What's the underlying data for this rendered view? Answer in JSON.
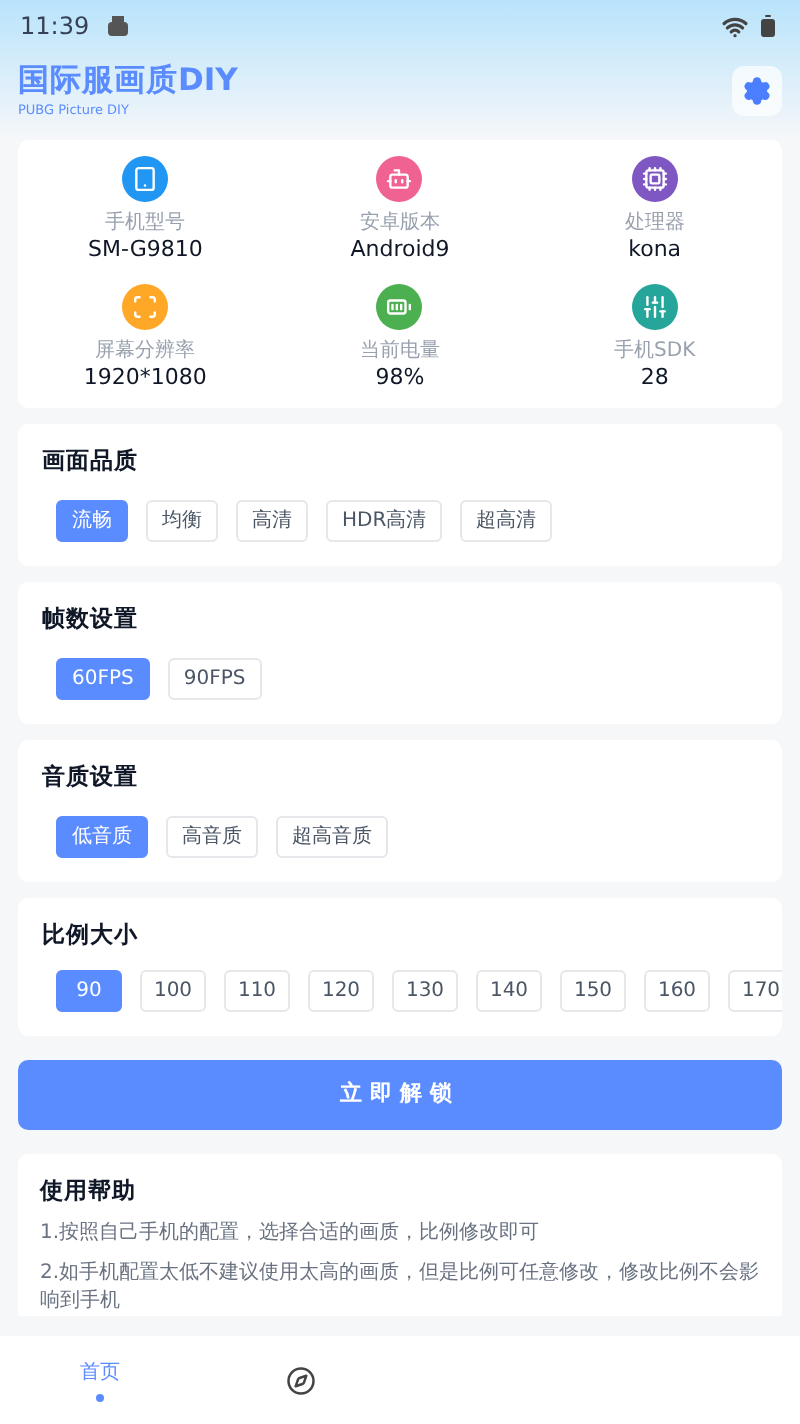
{
  "status_bar": {
    "time": "11:39"
  },
  "header": {
    "title": "国际服画质DIY",
    "subtitle": "PUBG Picture DIY"
  },
  "device_info": [
    {
      "kind": "tablet",
      "label": "手机型号",
      "value": "SM-G9810",
      "color": "#2196f3"
    },
    {
      "kind": "android",
      "label": "安卓版本",
      "value": "Android9",
      "color": "#f06292"
    },
    {
      "kind": "cpu",
      "label": "处理器",
      "value": "kona",
      "color": "#7e57c2"
    },
    {
      "kind": "screen",
      "label": "屏幕分辨率",
      "value": "1920*1080",
      "color": "#ffa726"
    },
    {
      "kind": "battery",
      "label": "当前电量",
      "value": "98%",
      "color": "#4caf50"
    },
    {
      "kind": "sliders",
      "label": "手机SDK",
      "value": "28",
      "color": "#26a69a"
    }
  ],
  "sections": [
    {
      "title": "画面品质",
      "options": [
        {
          "label": "流畅",
          "selected": true
        },
        {
          "label": "均衡",
          "selected": false
        },
        {
          "label": "高清",
          "selected": false
        },
        {
          "label": "HDR高清",
          "selected": false
        },
        {
          "label": "超高清",
          "selected": false
        }
      ]
    },
    {
      "title": "帧数设置",
      "options": [
        {
          "label": "60FPS",
          "selected": true
        },
        {
          "label": "90FPS",
          "selected": false
        }
      ]
    },
    {
      "title": "音质设置",
      "options": [
        {
          "label": "低音质",
          "selected": true
        },
        {
          "label": "高音质",
          "selected": false
        },
        {
          "label": "超高音质",
          "selected": false
        }
      ]
    },
    {
      "title": "比例大小",
      "compact": true,
      "options": [
        {
          "label": "90",
          "selected": true
        },
        {
          "label": "100",
          "selected": false
        },
        {
          "label": "110",
          "selected": false
        },
        {
          "label": "120",
          "selected": false
        },
        {
          "label": "130",
          "selected": false
        },
        {
          "label": "140",
          "selected": false
        },
        {
          "label": "150",
          "selected": false
        },
        {
          "label": "160",
          "selected": false
        },
        {
          "label": "170",
          "selected": false
        }
      ]
    }
  ],
  "unlock_button": "立即解锁",
  "help": {
    "title": "使用帮助",
    "lines": [
      "1.按照自己手机的配置，选择合适的画质，比例修改即可",
      "2.如手机配置太低不建议使用太高的画质，但是比例可任意修改，修改比例不会影响到手机"
    ]
  },
  "bottom_nav": [
    {
      "kind": "text",
      "label": "首页",
      "selected": true
    },
    {
      "kind": "compass",
      "selected": false
    }
  ]
}
